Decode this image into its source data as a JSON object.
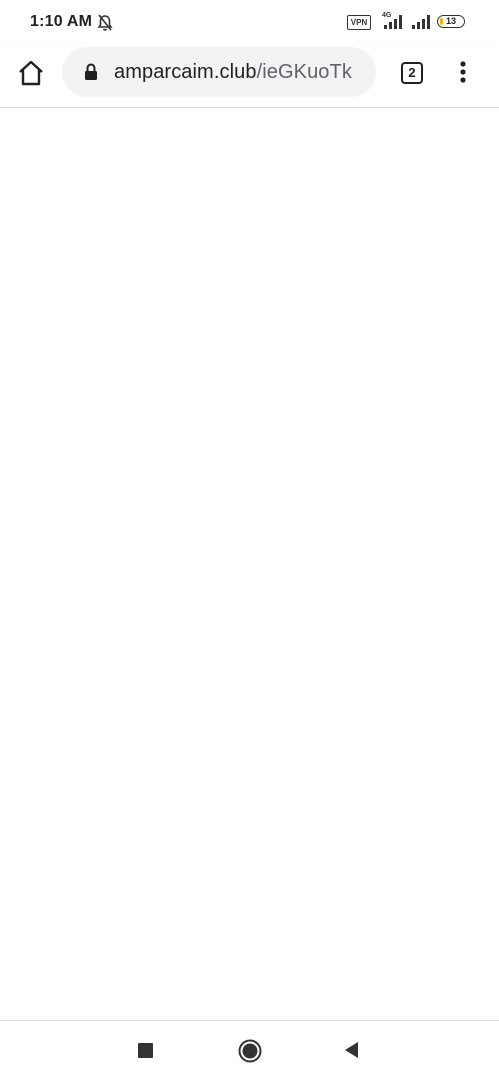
{
  "status_bar": {
    "time": "1:10 AM",
    "icons": [
      "notifications-off-icon",
      "vpn-icon",
      "signal-icon",
      "signal-icon",
      "battery-icon"
    ],
    "vpn_label": "VPN",
    "network_label": "4G",
    "battery_level": "13",
    "battery_color": "#f2b400"
  },
  "toolbar": {
    "home_icon": "home-icon",
    "lock_icon": "lock-icon",
    "url_domain": "amparcaim.club",
    "url_path": "/ieGKuoTk",
    "tab_count": "2",
    "menu_icon": "more-vert-icon"
  },
  "nav_bar": {
    "icons": [
      "recents-icon",
      "home-icon",
      "back-icon"
    ]
  }
}
